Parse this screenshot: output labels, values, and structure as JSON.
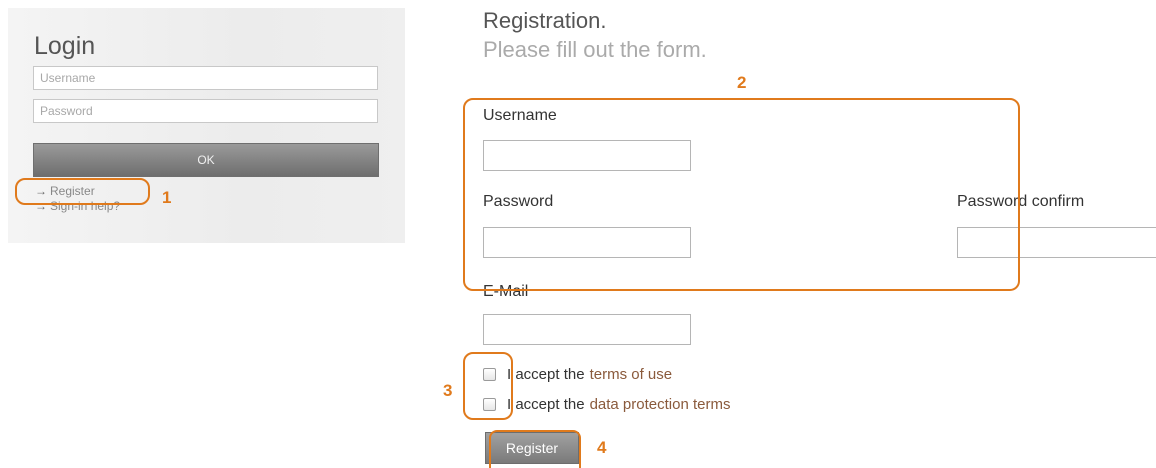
{
  "login": {
    "title": "Login",
    "username_placeholder": "Username",
    "password_placeholder": "Password",
    "ok_label": "OK",
    "register_link": "Register",
    "signin_help_link": "Sign-in help?",
    "arrow_glyph": "→"
  },
  "registration": {
    "title": "Registration.",
    "subtitle": "Please fill out the form.",
    "username_label": "Username",
    "password_label": "Password",
    "password_confirm_label": "Password confirm",
    "email_label": "E-Mail",
    "accept_terms_prefix": "I accept the",
    "terms_of_use_link": "terms of use",
    "accept_data_prefix": "I accept the",
    "data_protection_link": "data protection terms",
    "register_button": "Register"
  },
  "annotations": {
    "callout_1": "1",
    "callout_2": "2",
    "callout_3": "3",
    "callout_4": "4",
    "color": "#e07a1c"
  }
}
